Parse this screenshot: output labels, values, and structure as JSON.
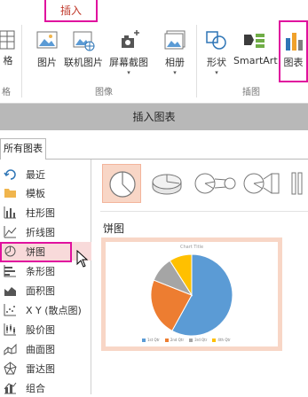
{
  "ribbon": {
    "tab_label": "插入",
    "left_partial_label": "格",
    "left_partial_group": "格",
    "buttons": [
      {
        "label": "图片",
        "icon": "picture-icon"
      },
      {
        "label": "联机图片",
        "icon": "online-picture-icon"
      },
      {
        "label": "屏幕截图",
        "icon": "screenshot-icon"
      },
      {
        "label": "相册",
        "icon": "photo-album-icon"
      },
      {
        "label": "形状",
        "icon": "shapes-icon"
      },
      {
        "label": "SmartArt",
        "icon": "smartart-icon"
      },
      {
        "label": "图表",
        "icon": "chart-icon"
      }
    ],
    "groups": {
      "images": "图像",
      "illustrations": "插图"
    }
  },
  "dialog": {
    "title": "插入图表",
    "tab": "所有图表",
    "categories": [
      {
        "label": "最近",
        "icon": "recent-icon"
      },
      {
        "label": "模板",
        "icon": "template-folder-icon"
      },
      {
        "label": "柱形图",
        "icon": "column-chart-icon"
      },
      {
        "label": "折线图",
        "icon": "line-chart-icon"
      },
      {
        "label": "饼图",
        "icon": "pie-chart-icon"
      },
      {
        "label": "条形图",
        "icon": "bar-chart-icon"
      },
      {
        "label": "面积图",
        "icon": "area-chart-icon"
      },
      {
        "label": "X Y (散点图)",
        "icon": "scatter-chart-icon"
      },
      {
        "label": "股价图",
        "icon": "stock-chart-icon"
      },
      {
        "label": "曲面图",
        "icon": "surface-chart-icon"
      },
      {
        "label": "雷达图",
        "icon": "radar-chart-icon"
      },
      {
        "label": "组合",
        "icon": "combo-chart-icon"
      }
    ],
    "selected_category": "饼图",
    "preview_title": "饼图",
    "preview_chart_title": "Chart Title",
    "legend": [
      "1st Qtr",
      "2nd Qtr",
      "3rd Qtr",
      "4th Qtr"
    ],
    "pie_colors": [
      "#5b9bd5",
      "#ed7d31",
      "#a5a5a5",
      "#ffc000"
    ],
    "pie_values": [
      58,
      23,
      10,
      9
    ]
  }
}
